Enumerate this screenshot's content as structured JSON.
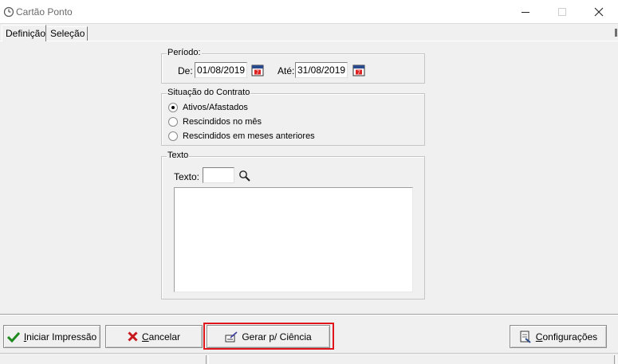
{
  "window": {
    "title": "Cartão Ponto"
  },
  "tabs": [
    {
      "label": "Definição"
    },
    {
      "label": "Seleção"
    }
  ],
  "periodo": {
    "legend": "Período:",
    "de_label": "De:",
    "de_value": "01/08/2019",
    "ate_label": "Até:",
    "ate_value": "31/08/2019"
  },
  "situacao": {
    "legend": "Situação do Contrato",
    "options": [
      {
        "label": "Ativos/Afastados",
        "selected": true
      },
      {
        "label": "Rescindidos no mês",
        "selected": false
      },
      {
        "label": "Rescindidos em meses anteriores",
        "selected": false
      }
    ]
  },
  "texto": {
    "legend": "Texto",
    "field_label": "Texto:",
    "field_value": "",
    "memo_value": ""
  },
  "buttons": {
    "iniciar_prefix": "I",
    "iniciar_rest": "niciar Impressão",
    "cancelar_prefix": "C",
    "cancelar_rest": "ancelar",
    "gerar": "Gerar p/ Ciência",
    "config_prefix": "C",
    "config_rest": "onfigurações"
  },
  "colors": {
    "highlight": "#e0161c",
    "check_green": "#1e8a1e",
    "cancel_red": "#c8181c"
  },
  "icons": {
    "app": "clock-icon",
    "calendar": "calendar-icon",
    "search": "magnifier-icon",
    "iniciar": "check-icon",
    "cancelar": "x-icon",
    "gerar": "sign-document-icon",
    "config": "settings-document-icon"
  }
}
